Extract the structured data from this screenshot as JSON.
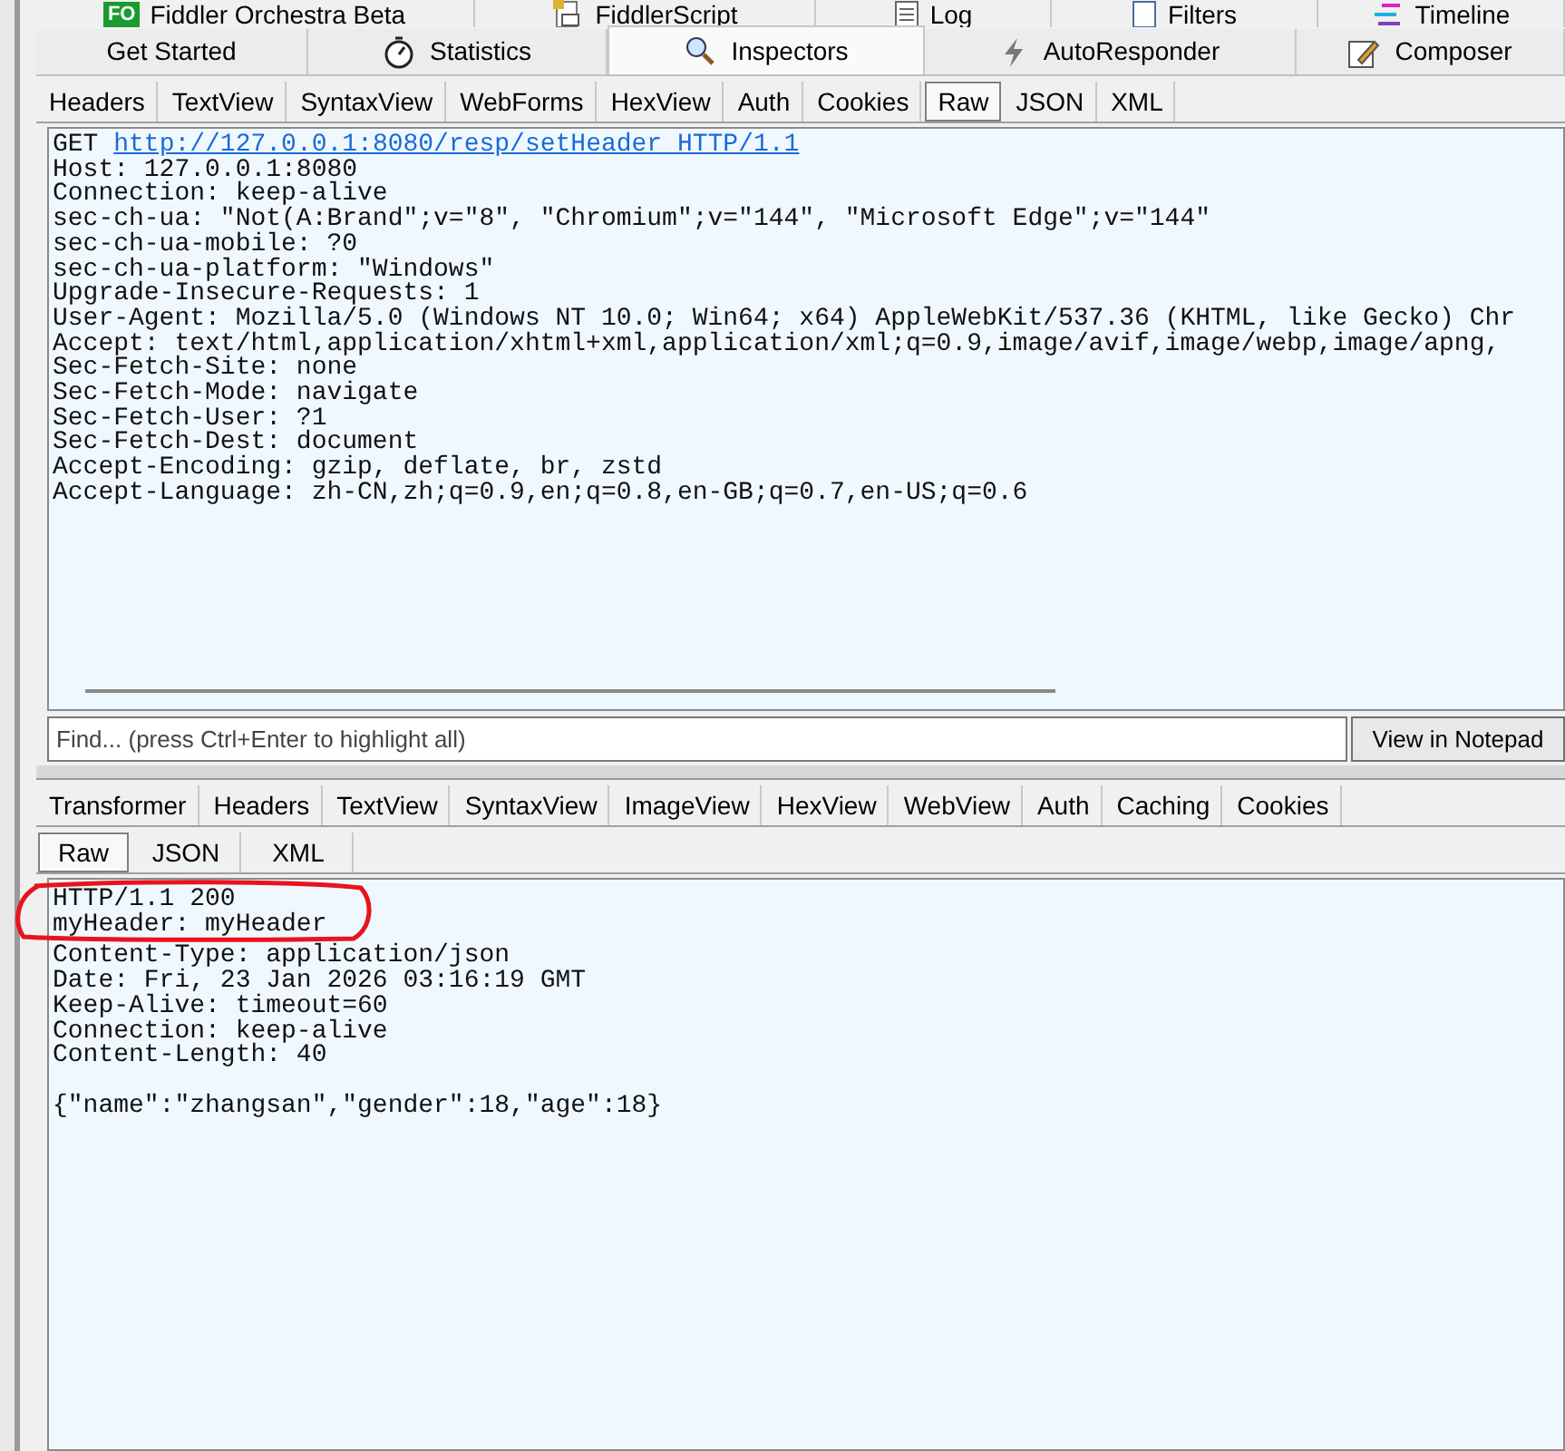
{
  "top_tabs": [
    {
      "label": "Fiddler Orchestra Beta",
      "badge": "FO"
    },
    {
      "label": "FiddlerScript"
    },
    {
      "label": "Log"
    },
    {
      "label": "Filters"
    },
    {
      "label": "Timeline"
    }
  ],
  "main_tabs": [
    {
      "label": "Get Started",
      "selected": false
    },
    {
      "label": "Statistics",
      "selected": false
    },
    {
      "label": "Inspectors",
      "selected": true
    },
    {
      "label": "AutoResponder",
      "selected": false
    },
    {
      "label": "Composer",
      "selected": false
    }
  ],
  "request": {
    "tabs": [
      {
        "label": "Headers",
        "selected": false
      },
      {
        "label": "TextView",
        "selected": false
      },
      {
        "label": "SyntaxView",
        "selected": false
      },
      {
        "label": "WebForms",
        "selected": false
      },
      {
        "label": "HexView",
        "selected": false
      },
      {
        "label": "Auth",
        "selected": false
      },
      {
        "label": "Cookies",
        "selected": false
      },
      {
        "label": "Raw",
        "selected": true
      },
      {
        "label": "JSON",
        "selected": false
      },
      {
        "label": "XML",
        "selected": false
      }
    ],
    "request_line": {
      "method": "GET",
      "url": "http://127.0.0.1:8080/resp/setHeader HTTP/1.1"
    },
    "lines": [
      "Host: 127.0.0.1:8080",
      "Connection: keep-alive",
      "sec-ch-ua: \"Not(A:Brand\";v=\"8\", \"Chromium\";v=\"144\", \"Microsoft Edge\";v=\"144\"",
      "sec-ch-ua-mobile: ?0",
      "sec-ch-ua-platform: \"Windows\"",
      "Upgrade-Insecure-Requests: 1",
      "User-Agent: Mozilla/5.0 (Windows NT 10.0; Win64; x64) AppleWebKit/537.36 (KHTML, like Gecko) Chr",
      "Accept: text/html,application/xhtml+xml,application/xml;q=0.9,image/avif,image/webp,image/apng,",
      "Sec-Fetch-Site: none",
      "Sec-Fetch-Mode: navigate",
      "Sec-Fetch-User: ?1",
      "Sec-Fetch-Dest: document",
      "Accept-Encoding: gzip, deflate, br, zstd",
      "Accept-Language: zh-CN,zh;q=0.9,en;q=0.8,en-GB;q=0.7,en-US;q=0.6"
    ],
    "find": {
      "placeholder": "Find... (press Ctrl+Enter to highlight all)"
    },
    "notepad_button": "View in Notepad"
  },
  "response": {
    "tabs": [
      {
        "label": "Transformer",
        "selected": false
      },
      {
        "label": "Headers",
        "selected": false
      },
      {
        "label": "TextView",
        "selected": false
      },
      {
        "label": "SyntaxView",
        "selected": false
      },
      {
        "label": "ImageView",
        "selected": false
      },
      {
        "label": "HexView",
        "selected": false
      },
      {
        "label": "WebView",
        "selected": false
      },
      {
        "label": "Auth",
        "selected": false
      },
      {
        "label": "Caching",
        "selected": false
      },
      {
        "label": "Cookies",
        "selected": false
      }
    ],
    "subtabs": [
      {
        "label": "Raw",
        "selected": true
      },
      {
        "label": "JSON",
        "selected": false
      },
      {
        "label": "XML",
        "selected": false
      }
    ],
    "lines": [
      "HTTP/1.1 200",
      "myHeader: myHeader",
      "Content-Type: application/json",
      "Date: Fri, 23 Jan 2026 03:16:19 GMT",
      "Keep-Alive: timeout=60",
      "Connection: keep-alive",
      "Content-Length: 40"
    ],
    "body": "{\"name\":\"zhangsan\",\"gender\":18,\"age\":18}"
  }
}
